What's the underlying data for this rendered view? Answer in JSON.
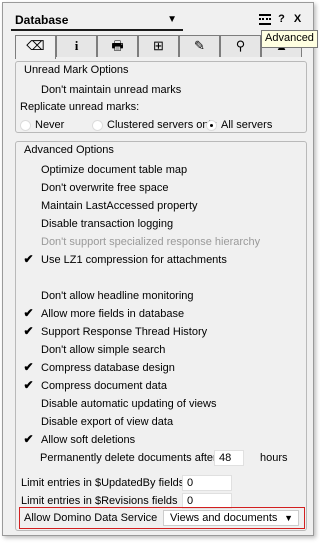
{
  "header": {
    "title": "Database",
    "ctrl_help": "?",
    "ctrl_close": "X"
  },
  "tabs": [
    {
      "icon": "eraser-icon",
      "glyph": "⌫"
    },
    {
      "icon": "info-icon",
      "glyph": "i"
    },
    {
      "icon": "printer-icon",
      "glyph": "🖶"
    },
    {
      "icon": "design-icon",
      "glyph": "⊞"
    },
    {
      "icon": "brush-icon",
      "glyph": "✎"
    },
    {
      "icon": "search-icon",
      "glyph": "⚲"
    },
    {
      "icon": "advanced-icon",
      "glyph": "▲"
    }
  ],
  "tooltip": "Advanced",
  "unread": {
    "title": "Unread Mark Options",
    "dont_maintain": "Don't maintain unread marks",
    "replicate_label": "Replicate unread marks:",
    "radio_never": "Never",
    "radio_clustered": "Clustered servers only",
    "radio_all": "All servers",
    "selected": "All servers"
  },
  "advanced": {
    "title": "Advanced Options",
    "options": [
      {
        "label": "Optimize document table map",
        "checked": false,
        "disabled": false
      },
      {
        "label": "Don't overwrite free space",
        "checked": false,
        "disabled": false
      },
      {
        "label": "Maintain LastAccessed property",
        "checked": false,
        "disabled": false
      },
      {
        "label": "Disable transaction logging",
        "checked": false,
        "disabled": false
      },
      {
        "label": "Don't support specialized response hierarchy",
        "checked": false,
        "disabled": true
      },
      {
        "label": "Use LZ1 compression for attachments",
        "checked": true,
        "disabled": false
      },
      {
        "label": "Don't allow headline monitoring",
        "checked": false,
        "disabled": false
      },
      {
        "label": "Allow more fields in database",
        "checked": true,
        "disabled": false
      },
      {
        "label": "Support Response Thread History",
        "checked": true,
        "disabled": false
      },
      {
        "label": "Don't allow simple search",
        "checked": false,
        "disabled": false
      },
      {
        "label": "Compress database design",
        "checked": true,
        "disabled": false
      },
      {
        "label": "Compress document data",
        "checked": true,
        "disabled": false
      },
      {
        "label": "Disable automatic updating of views",
        "checked": false,
        "disabled": false
      },
      {
        "label": "Disable export of view data",
        "checked": false,
        "disabled": false
      },
      {
        "label": "Allow soft deletions",
        "checked": true,
        "disabled": false
      }
    ],
    "perm_delete_label": "Permanently delete documents after",
    "perm_delete_value": "48",
    "perm_delete_unit": "hours",
    "updatedby_label": "Limit entries in $UpdatedBy fields",
    "updatedby_value": "0",
    "revisions_label": "Limit entries in $Revisions fields",
    "revisions_value": "0",
    "domino_label": "Allow Domino Data Service",
    "domino_value": "Views and documents"
  },
  "check_mark": "✔"
}
